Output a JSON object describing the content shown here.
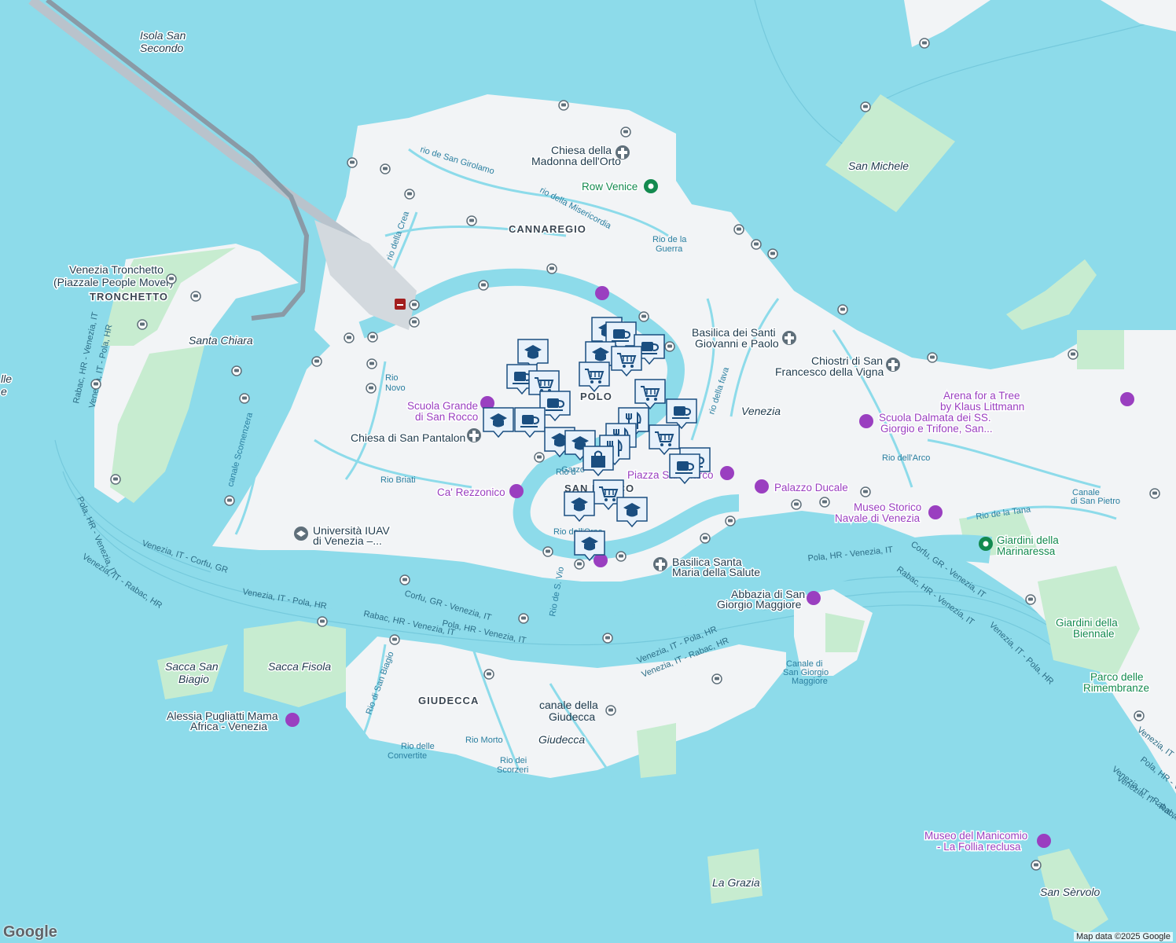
{
  "map": {
    "attribution": "Map data ©2025 Google",
    "logo": "Google",
    "colors": {
      "water": "#8ddbea",
      "land": "#f2f4f6",
      "park": "#c7ecd0",
      "poi": "#9a3fc0",
      "park_text": "#138a4f",
      "marker": "#1a4e80"
    },
    "districts": {
      "cannaregio": "CANNAREGIO",
      "tronchetto": "TRONCHETTO",
      "giudecca": "GIUDECCA",
      "polo": "POLO",
      "sanmarco": "SAN MARCO"
    },
    "places": {
      "isola_san_secondo_1": "Isola San",
      "isola_san_secondo_2": "Secondo",
      "san_michele": "San Michele",
      "santa_chiara": "Santa Chiara",
      "venezia": "Venezia",
      "sacca_san_biagio_1": "Sacca San",
      "sacca_san_biagio_2": "Biagio",
      "sacca_fisola": "Sacca Fisola",
      "giudecca": "Giudecca",
      "la_grazia": "La Grazia",
      "san_servolo": "San Sèrvolo",
      "tronchetto_station_1": "Venezia Tronchetto",
      "tronchetto_station_2": "(Piazzale People Mover)",
      "row_venice": "Row Venice",
      "giardini_marinaressa_1": "Giardini della",
      "giardini_marinaressa_2": "Marinaressa",
      "giardini_biennale_1": "Giardini della",
      "giardini_biennale_2": "Biennale",
      "parco_rimembranze_1": "Parco delle",
      "parco_rimembranze_2": "Rimembranze",
      "edge_1": "lle",
      "edge_2": "e"
    },
    "pois": {
      "madonna_orto_1": "Chiesa della",
      "madonna_orto_2": "Madonna dell'Orto",
      "santi_giovanni_1": "Basilica dei Santi",
      "santi_giovanni_2": "Giovanni e Paolo",
      "chiostri_1": "Chiostri di San",
      "chiostri_2": "Francesco della Vigna",
      "arena_1": "Arena for a Tree",
      "arena_2": "by Klaus Littmann",
      "scuola_rocco_1": "Scuola Grande",
      "scuola_rocco_2": "di San Rocco",
      "scuola_dalmata_1": "Scuola Dalmata dei SS.",
      "scuola_dalmata_2": "Giorgio e Trifone, San...",
      "san_pantalon": "Chiesa di San Pantalon",
      "rezzonico": "Ca' Rezzonico",
      "piazza": "Piazza San Marco",
      "ducale": "Palazzo Ducale",
      "museo_navale_1": "Museo Storico",
      "museo_navale_2": "Navale di Venezia",
      "iuav_1": "Università IUAV",
      "iuav_2": "di Venezia –...",
      "salute_1": "Basilica Santa",
      "salute_2": "Maria della Salute",
      "san_giorgio_1": "Abbazia di San",
      "san_giorgio_2": "Giorgio Maggiore",
      "mama_africa_1": "Alessia Pugliatti Mama",
      "mama_africa_2": "Africa - Venezia",
      "manicomio_1": "Museo del Manicomio",
      "manicomio_2": "- La Follia reclusa"
    },
    "canals": {
      "girolamo": "rio de San Girolamo",
      "misericordia": "rio della Misericordia",
      "crea": "rio della Crea",
      "guerra_1": "Rio de la",
      "guerra_2": "Guerra",
      "fava": "rio della fava",
      "rio_novo_1": "Rio",
      "rio_novo_2": "Novo",
      "scomenzera": "canale Scomenzera",
      "briati": "Rio Briati",
      "arco": "Rio dell'Arco",
      "pietro_1": "Canale",
      "pietro_2": "di San Pietro",
      "tana": "Rio de la Tana",
      "orso": "Rio dell'Orso",
      "vio": "Rio de S. Vio",
      "giudecca_canal_1": "canale della",
      "giudecca_canal_2": "Giudecca",
      "morto": "Rio Morto",
      "convertite_1": "Rio delle",
      "convertite_2": "Convertite",
      "scorzeri_1": "Rio dei",
      "scorzeri_2": "Scorzeri",
      "san_biagio": "Rio di San Biagio",
      "san_giorgio_canal_1": "Canale di",
      "san_giorgio_canal_2": "San Giorgio",
      "san_giorgio_canal_3": "Maggiore",
      "garzoni_1": "Rio d",
      "garzoni_2": "Garzo"
    },
    "ferry_routes": {
      "r1": "Venezia, IT - Corfu, GR",
      "r2": "Venezia, IT - Pola, HR",
      "r3": "Venezia, IT - Rabac, HR",
      "r4": "Corfu, GR - Venezia, IT",
      "r5": "Rabac, HR - Venezia, IT",
      "r6": "Pola, HR - Venezia, IT",
      "r7": "Venezia, IT - Pola, HR",
      "r8": "Venezia, IT - Rabac, HR",
      "r9": "Pola, HR - Venezia, IT",
      "r10": "Corfu, GR - Venezia, IT",
      "r11": "Rabac, HR - Venezia, IT",
      "r12": "Venezia, IT - Pola, HR",
      "r13": "Rabac, HR - Venezia, IT",
      "r14": "Venezia, IT - Pola, HR",
      "r15": "Pola, HR - Venezia, IT",
      "r16": "Venezia, IT - Rabac, HR",
      "r17": "Venezia, IT",
      "r18": "Pola, HR - Venez",
      "r19": "Venezia, IT - Raba"
    },
    "marker_icons": [
      "school-icon",
      "cafe-icon",
      "shopping-cart-icon",
      "shopping-bag-icon",
      "restaurant-icon",
      "ferry-stop-icon",
      "train-station-icon",
      "church-icon",
      "museum-icon",
      "park-icon",
      "university-icon"
    ]
  }
}
